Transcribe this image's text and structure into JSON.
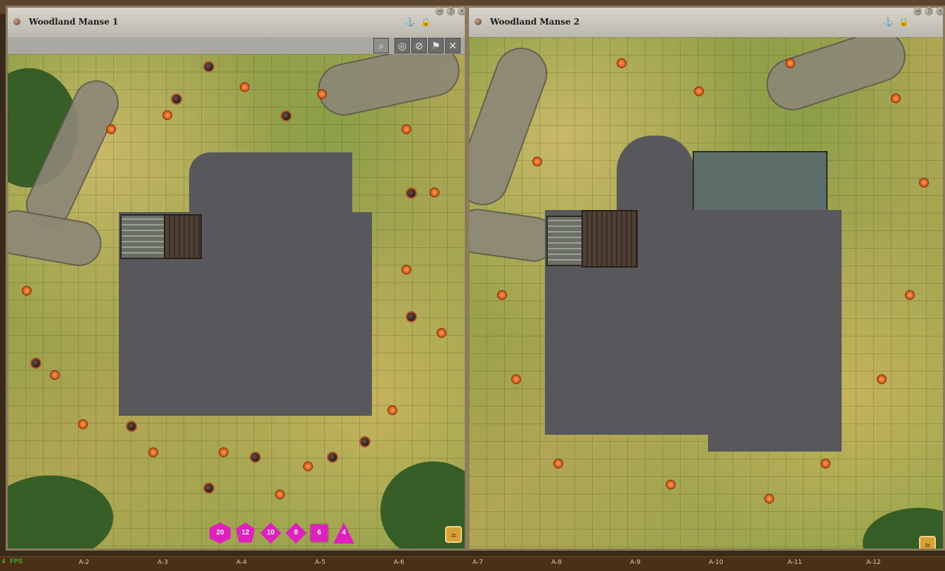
{
  "panels": [
    {
      "title": "Woodland Manse 1"
    },
    {
      "title": "Woodland Manse 2"
    }
  ],
  "window_controls": [
    "link-icon",
    "help-icon",
    "close-icon"
  ],
  "title_icons": [
    "anchor-icon",
    "lock-icon"
  ],
  "toolbar": [
    "zoom-icon",
    "target-icon",
    "mask-icon",
    "flag-icon",
    "close-icon"
  ],
  "dice": [
    "d20",
    "d12",
    "d10",
    "d8",
    "d6",
    "d4"
  ],
  "dice_labels": [
    "20",
    "12",
    "10",
    "8",
    "6",
    "4"
  ],
  "footer": {
    "fps": "4 FPS",
    "cells": [
      "A-2",
      "A-3",
      "A-4",
      "A-5",
      "A-6",
      "A-7",
      "A-8",
      "A-9",
      "A-10",
      "A-11",
      "A-12"
    ]
  },
  "colors": {
    "grass": "#8fa449",
    "fog": "#58585c",
    "dice": "#e01fbf",
    "token_ring": "#b3562a"
  }
}
